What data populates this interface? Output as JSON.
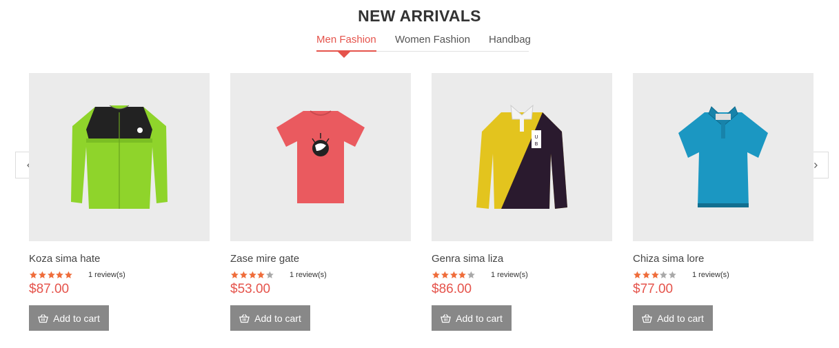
{
  "section": {
    "title": "NEW ARRIVALS"
  },
  "tabs": [
    {
      "label": "Men Fashion",
      "active": true
    },
    {
      "label": "Women Fashion",
      "active": false
    },
    {
      "label": "Handbag",
      "active": false
    }
  ],
  "colors": {
    "accent": "#e5534b",
    "button": "#888888",
    "star_filled": "#ef6d3b",
    "star_empty": "#a9a9a9",
    "image_bg": "#ebebeb"
  },
  "carousel": {
    "prev_icon": "chevron-left-icon",
    "next_icon": "chevron-right-icon"
  },
  "products": [
    {
      "name": "Koza sima hate",
      "rating": 5,
      "reviews": "1 review(s)",
      "price": "$87.00",
      "cart_label": "Add to cart",
      "image": "green-black-long-sleeve-shirt"
    },
    {
      "name": "Zase mire gate",
      "rating": 4,
      "reviews": "1 review(s)",
      "price": "$53.00",
      "cart_label": "Add to cart",
      "image": "red-graphic-t-shirt"
    },
    {
      "name": "Genra sima liza",
      "rating": 4,
      "reviews": "1 review(s)",
      "price": "$86.00",
      "cart_label": "Add to cart",
      "image": "yellow-purple-rugby-shirt"
    },
    {
      "name": "Chiza sima lore",
      "rating": 3,
      "reviews": "1 review(s)",
      "price": "$77.00",
      "cart_label": "Add to cart",
      "image": "blue-polo-shirt"
    }
  ]
}
